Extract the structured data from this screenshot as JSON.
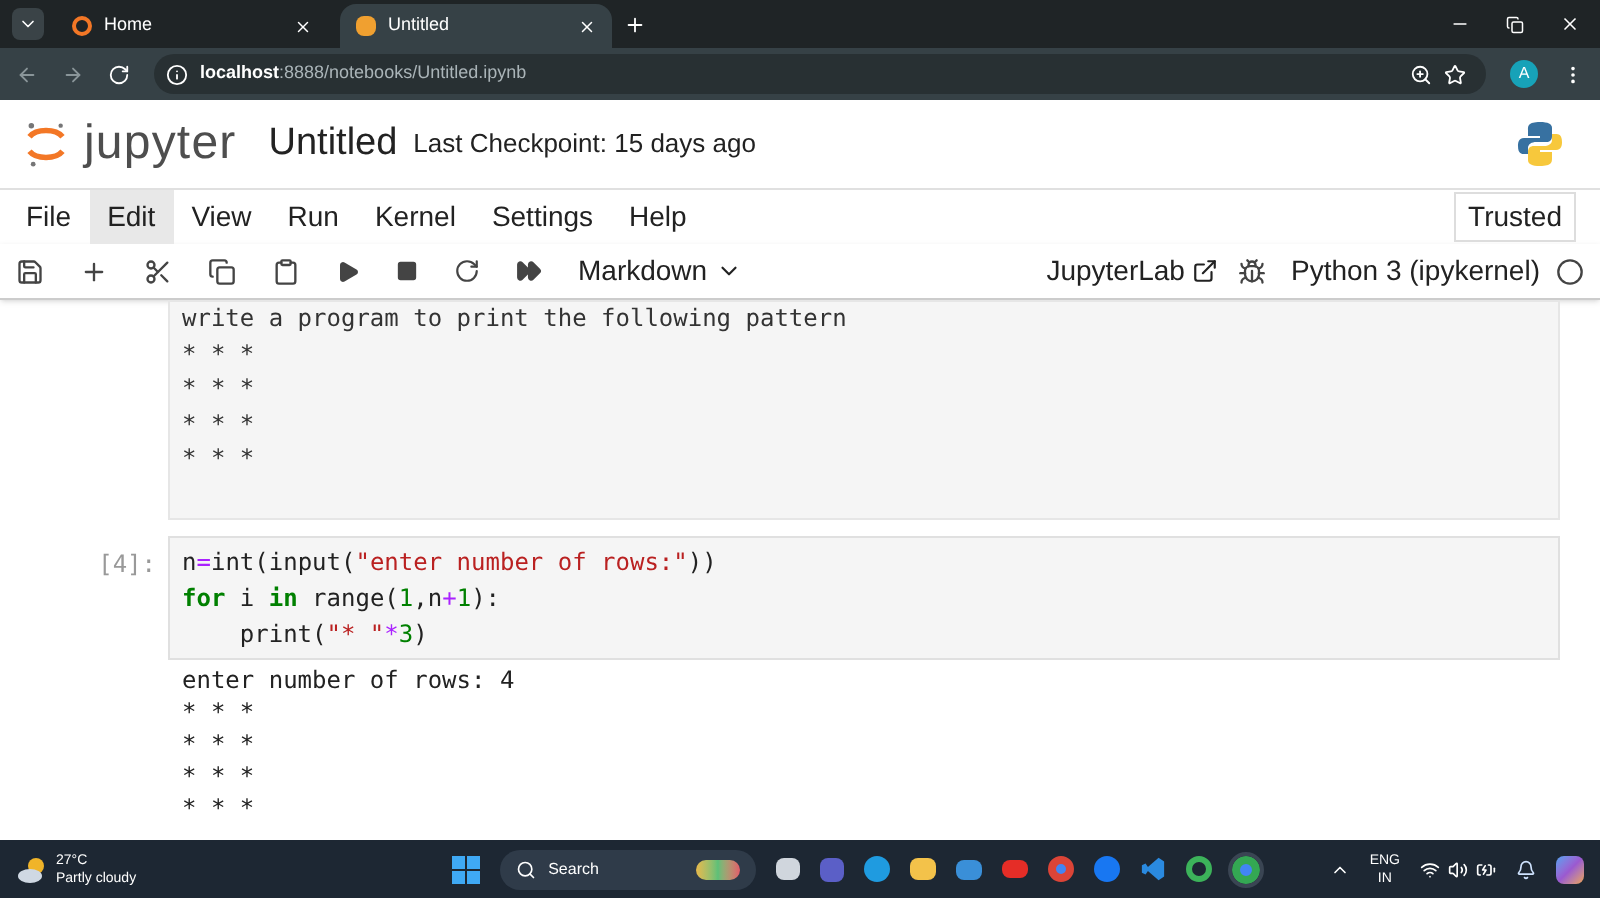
{
  "browser": {
    "tabs": [
      {
        "label": "Home",
        "selected": false
      },
      {
        "label": "Untitled",
        "selected": true
      }
    ],
    "address": {
      "host": "localhost",
      "path": ":8888/notebooks/Untitled.ipynb"
    },
    "profile": "A"
  },
  "notebook": {
    "logo": "jupyter",
    "title": "Untitled",
    "checkpoint": "Last Checkpoint: 15 days ago",
    "menu": [
      {
        "label": "File",
        "selected": false
      },
      {
        "label": "Edit",
        "selected": true
      },
      {
        "label": "View",
        "selected": false
      },
      {
        "label": "Run",
        "selected": false
      },
      {
        "label": "Kernel",
        "selected": false
      },
      {
        "label": "Settings",
        "selected": false
      },
      {
        "label": "Help",
        "selected": false
      }
    ],
    "trusted": "Trusted",
    "cell_type": "Markdown",
    "lab_link": "JupyterLab",
    "kernel": "Python 3 (ipykernel)",
    "cells": [
      {
        "kind": "markdown",
        "lines": [
          "write a program to print the following pattern",
          "* * *",
          "* * *",
          "* * *",
          "* * *"
        ]
      },
      {
        "kind": "code",
        "prompt": "[4]:",
        "code": [
          [
            {
              "t": "n",
              "kind": "plain"
            },
            {
              "t": "=",
              "kind": "op"
            },
            {
              "t": "int(input(",
              "kind": "plain"
            },
            {
              "t": "\"enter number of rows:\"",
              "kind": "string"
            },
            {
              "t": "))",
              "kind": "plain"
            }
          ],
          [
            {
              "t": "for",
              "kind": "keyword"
            },
            {
              "t": " i ",
              "kind": "plain"
            },
            {
              "t": "in",
              "kind": "keyword"
            },
            {
              "t": " range(",
              "kind": "plain"
            },
            {
              "t": "1",
              "kind": "number"
            },
            {
              "t": ",n",
              "kind": "plain"
            },
            {
              "t": "+",
              "kind": "op"
            },
            {
              "t": "1",
              "kind": "number"
            },
            {
              "t": "):",
              "kind": "plain"
            }
          ],
          [
            {
              "t": "    print(",
              "kind": "plain"
            },
            {
              "t": "\"* \"",
              "kind": "string"
            },
            {
              "t": "*",
              "kind": "op"
            },
            {
              "t": "3",
              "kind": "number"
            },
            {
              "t": ")",
              "kind": "plain"
            }
          ]
        ],
        "output": [
          "enter number of rows: 4",
          "* * *",
          "* * *",
          "* * *",
          "* * *"
        ]
      }
    ]
  },
  "taskbar": {
    "temperature": "27°C",
    "weather": "Partly cloudy",
    "search": "Search",
    "language": "ENG",
    "region": "IN"
  }
}
